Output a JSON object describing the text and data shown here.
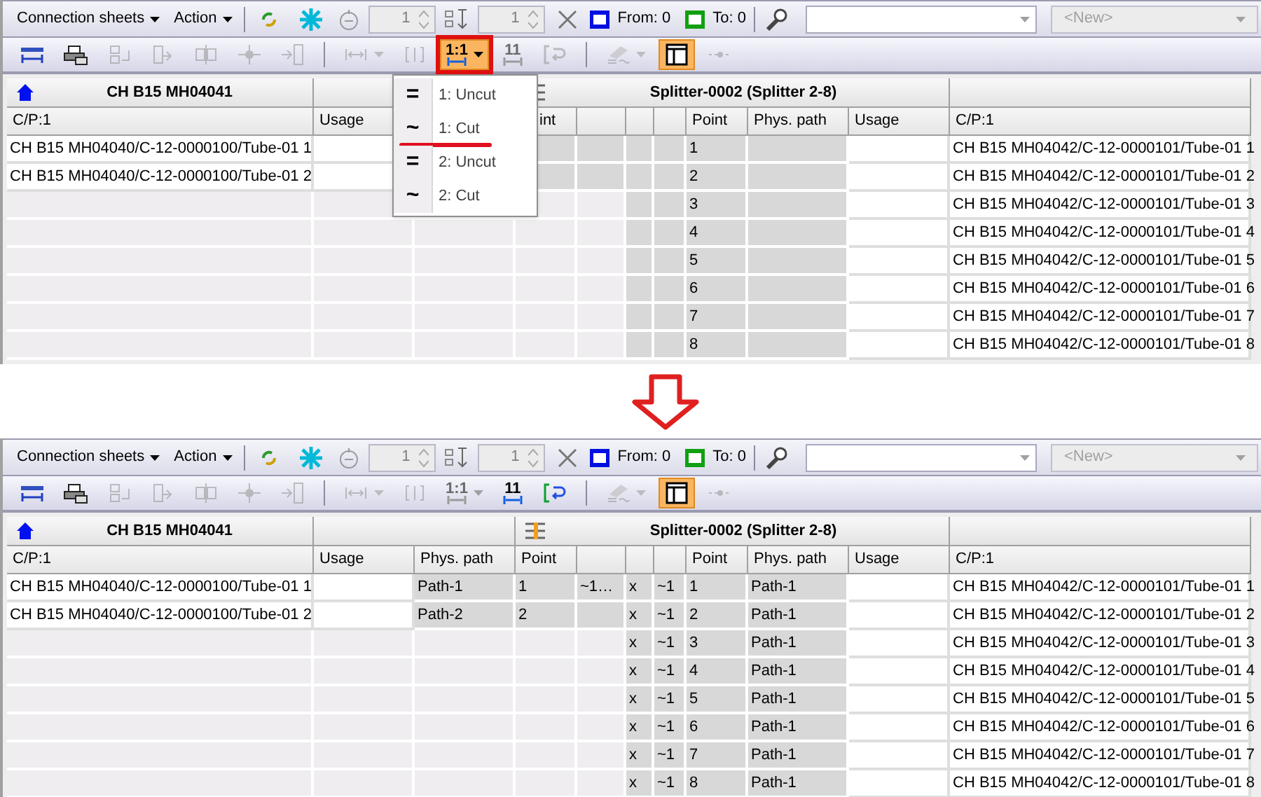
{
  "panels": [
    {
      "toolbar": {
        "menus": [
          "Connection sheets",
          "Action"
        ],
        "spin_1": "1",
        "spin_2": "1",
        "from": "From: 0",
        "to": "To: 0",
        "combo_new": "<New>"
      },
      "tools": [
        {
          "kind": "ruler",
          "disabled": false,
          "active": false
        },
        {
          "kind": "printer",
          "disabled": false,
          "active": false
        },
        {
          "kind": "box-in",
          "disabled": true,
          "active": false
        },
        {
          "kind": "box-out",
          "disabled": true,
          "active": false
        },
        {
          "kind": "split",
          "disabled": true,
          "active": false
        },
        {
          "kind": "node",
          "disabled": true,
          "active": false
        },
        {
          "kind": "insert",
          "disabled": true,
          "active": false
        },
        {
          "kind": "separator"
        },
        {
          "kind": "span",
          "disabled": true,
          "active": false,
          "dropdown": true
        },
        {
          "kind": "bracket",
          "disabled": true,
          "active": false
        },
        {
          "kind": "ratio",
          "label": "1:1",
          "disabled": false,
          "active": true,
          "dropdown": true,
          "marked": true
        },
        {
          "kind": "ratio",
          "label": "11",
          "disabled": true,
          "active": false
        },
        {
          "kind": "swap",
          "disabled": true,
          "active": false
        },
        {
          "kind": "separator"
        },
        {
          "kind": "wave",
          "disabled": true,
          "active": false,
          "dropdown": true
        },
        {
          "kind": "layout",
          "disabled": false,
          "active": true
        },
        {
          "kind": "line",
          "disabled": true,
          "active": false
        }
      ],
      "table": {
        "groups": [
          {
            "kind": "device",
            "title": "CH B15 MH04041"
          },
          {
            "kind": "empty"
          },
          {
            "kind": "splitter",
            "title": "Splitter-0002 (Splitter 2-8)"
          },
          {
            "kind": "empty"
          }
        ],
        "columns": [
          {
            "label": "C/P:1"
          },
          {
            "label": "Usage"
          },
          null,
          {
            "label": "int",
            "clipped": true
          },
          {},
          {},
          {},
          {
            "label": "Point"
          },
          {
            "label": "Phys. path"
          },
          {
            "label": "Usage"
          },
          {
            "label": "C/P:1"
          }
        ],
        "rows": [
          [
            {
              "text": "CH B15 MH04040/C-12-0000100/Tube-01 1",
              "kind": "plain"
            },
            {
              "kind": "plain"
            },
            null,
            {
              "kind": "shaded"
            },
            {
              "kind": "shaded"
            },
            {
              "kind": "shaded"
            },
            {
              "kind": "shaded"
            },
            {
              "text": "1",
              "kind": "shaded"
            },
            {
              "kind": "shaded"
            },
            {
              "kind": "plain"
            },
            {
              "text": "CH B15 MH04042/C-12-0000101/Tube-01 1",
              "kind": "plain"
            }
          ],
          [
            {
              "text": "CH B15 MH04040/C-12-0000100/Tube-01 2",
              "kind": "plain"
            },
            {
              "kind": "plain"
            },
            null,
            {
              "kind": "shaded"
            },
            {
              "kind": "shaded"
            },
            {
              "kind": "shaded"
            },
            {
              "kind": "shaded"
            },
            {
              "text": "2",
              "kind": "shaded"
            },
            {
              "kind": "shaded"
            },
            {
              "kind": "plain"
            },
            {
              "text": "CH B15 MH04042/C-12-0000101/Tube-01 2",
              "kind": "plain"
            }
          ],
          [
            {
              "kind": "unused"
            },
            {
              "kind": "unused"
            },
            {
              "kind": "unused"
            },
            {
              "kind": "unused"
            },
            {
              "kind": "unused"
            },
            {
              "kind": "shaded"
            },
            {
              "kind": "shaded"
            },
            {
              "text": "3",
              "kind": "shaded"
            },
            {
              "kind": "shaded"
            },
            {
              "kind": "plain"
            },
            {
              "text": "CH B15 MH04042/C-12-0000101/Tube-01 3",
              "kind": "plain"
            }
          ],
          [
            {
              "kind": "unused"
            },
            {
              "kind": "unused"
            },
            {
              "kind": "unused"
            },
            {
              "kind": "unused"
            },
            {
              "kind": "unused"
            },
            {
              "kind": "shaded"
            },
            {
              "kind": "shaded"
            },
            {
              "text": "4",
              "kind": "shaded"
            },
            {
              "kind": "shaded"
            },
            {
              "kind": "plain"
            },
            {
              "text": "CH B15 MH04042/C-12-0000101/Tube-01 4",
              "kind": "plain"
            }
          ],
          [
            {
              "kind": "unused"
            },
            {
              "kind": "unused"
            },
            {
              "kind": "unused"
            },
            {
              "kind": "unused"
            },
            {
              "kind": "unused"
            },
            {
              "kind": "shaded"
            },
            {
              "kind": "shaded"
            },
            {
              "text": "5",
              "kind": "shaded"
            },
            {
              "kind": "shaded"
            },
            {
              "kind": "plain"
            },
            {
              "text": "CH B15 MH04042/C-12-0000101/Tube-01 5",
              "kind": "plain"
            }
          ],
          [
            {
              "kind": "unused"
            },
            {
              "kind": "unused"
            },
            {
              "kind": "unused"
            },
            {
              "kind": "unused"
            },
            {
              "kind": "unused"
            },
            {
              "kind": "shaded"
            },
            {
              "kind": "shaded"
            },
            {
              "text": "6",
              "kind": "shaded"
            },
            {
              "kind": "shaded"
            },
            {
              "kind": "plain"
            },
            {
              "text": "CH B15 MH04042/C-12-0000101/Tube-01 6",
              "kind": "plain"
            }
          ],
          [
            {
              "kind": "unused"
            },
            {
              "kind": "unused"
            },
            {
              "kind": "unused"
            },
            {
              "kind": "unused"
            },
            {
              "kind": "unused"
            },
            {
              "kind": "shaded"
            },
            {
              "kind": "shaded"
            },
            {
              "text": "7",
              "kind": "shaded"
            },
            {
              "kind": "shaded"
            },
            {
              "kind": "plain"
            },
            {
              "text": "CH B15 MH04042/C-12-0000101/Tube-01 7",
              "kind": "plain"
            }
          ],
          [
            {
              "kind": "unused"
            },
            {
              "kind": "unused"
            },
            {
              "kind": "unused"
            },
            {
              "kind": "unused"
            },
            {
              "kind": "unused"
            },
            {
              "kind": "shaded"
            },
            {
              "kind": "shaded"
            },
            {
              "text": "8",
              "kind": "shaded"
            },
            {
              "kind": "shaded"
            },
            {
              "kind": "plain"
            },
            {
              "text": "CH B15 MH04042/C-12-0000101/Tube-01 8",
              "kind": "plain"
            }
          ]
        ]
      },
      "menu": {
        "items": [
          {
            "glyph": "=",
            "label": "1: Uncut",
            "marked": false
          },
          {
            "glyph": "~",
            "label": "1: Cut",
            "marked": true
          },
          {
            "glyph": "=",
            "label": "2: Uncut",
            "marked": false
          },
          {
            "glyph": "~",
            "label": "2: Cut",
            "marked": false
          }
        ]
      }
    },
    {
      "toolbar": {
        "menus": [
          "Connection sheets",
          "Action"
        ],
        "spin_1": "1",
        "spin_2": "1",
        "from": "From: 0",
        "to": "To: 0",
        "combo_new": "<New>"
      },
      "tools": [
        {
          "kind": "ruler",
          "disabled": false,
          "active": false
        },
        {
          "kind": "printer",
          "disabled": false,
          "active": false
        },
        {
          "kind": "box-in",
          "disabled": true,
          "active": false
        },
        {
          "kind": "box-out",
          "disabled": true,
          "active": false
        },
        {
          "kind": "split",
          "disabled": true,
          "active": false
        },
        {
          "kind": "node",
          "disabled": true,
          "active": false
        },
        {
          "kind": "insert",
          "disabled": true,
          "active": false
        },
        {
          "kind": "separator"
        },
        {
          "kind": "span",
          "disabled": true,
          "active": false,
          "dropdown": true
        },
        {
          "kind": "bracket",
          "disabled": true,
          "active": false
        },
        {
          "kind": "ratio",
          "label": "1:1",
          "disabled": true,
          "active": false,
          "dropdown": true
        },
        {
          "kind": "ratio",
          "label": "11",
          "disabled": false,
          "active": false
        },
        {
          "kind": "swap",
          "disabled": false,
          "active": false
        },
        {
          "kind": "separator"
        },
        {
          "kind": "wave",
          "disabled": true,
          "active": false,
          "dropdown": true
        },
        {
          "kind": "layout",
          "disabled": false,
          "active": true
        },
        {
          "kind": "line",
          "disabled": true,
          "active": false
        }
      ],
      "table": {
        "groups": [
          {
            "kind": "device",
            "title": "CH B15 MH04041"
          },
          {
            "kind": "empty"
          },
          {
            "kind": "splitter",
            "title": "Splitter-0002 (Splitter 2-8)"
          },
          {
            "kind": "empty"
          }
        ],
        "columns": [
          {
            "label": "C/P:1"
          },
          {
            "label": "Usage"
          },
          {
            "label": "Phys. path"
          },
          {
            "label": "Point"
          },
          {},
          {},
          {},
          {
            "label": "Point"
          },
          {
            "label": "Phys. path"
          },
          {
            "label": "Usage"
          },
          {
            "label": "C/P:1"
          }
        ],
        "rows": [
          [
            {
              "text": "CH B15 MH04040/C-12-0000100/Tube-01 1",
              "kind": "plain"
            },
            {
              "kind": "plain"
            },
            {
              "text": "Path-1",
              "kind": "shaded"
            },
            {
              "text": "1",
              "kind": "shaded"
            },
            {
              "text": "~1…",
              "kind": "shaded"
            },
            {
              "text": "x",
              "kind": "shaded"
            },
            {
              "text": "~1",
              "kind": "shaded"
            },
            {
              "text": "1",
              "kind": "shaded"
            },
            {
              "text": "Path-1",
              "kind": "shaded"
            },
            {
              "kind": "plain"
            },
            {
              "text": "CH B15 MH04042/C-12-0000101/Tube-01 1",
              "kind": "plain"
            }
          ],
          [
            {
              "text": "CH B15 MH04040/C-12-0000100/Tube-01 2",
              "kind": "plain"
            },
            {
              "kind": "plain"
            },
            {
              "text": "Path-2",
              "kind": "shaded"
            },
            {
              "text": "2",
              "kind": "shaded"
            },
            {
              "kind": "shaded"
            },
            {
              "text": "x",
              "kind": "shaded"
            },
            {
              "text": "~1",
              "kind": "shaded"
            },
            {
              "text": "2",
              "kind": "shaded"
            },
            {
              "text": "Path-1",
              "kind": "shaded"
            },
            {
              "kind": "plain"
            },
            {
              "text": "CH B15 MH04042/C-12-0000101/Tube-01 2",
              "kind": "plain"
            }
          ],
          [
            {
              "kind": "unused"
            },
            {
              "kind": "unused"
            },
            {
              "kind": "unused"
            },
            {
              "kind": "unused"
            },
            {
              "kind": "unused"
            },
            {
              "text": "x",
              "kind": "shaded"
            },
            {
              "text": "~1",
              "kind": "shaded"
            },
            {
              "text": "3",
              "kind": "shaded"
            },
            {
              "text": "Path-1",
              "kind": "shaded"
            },
            {
              "kind": "plain"
            },
            {
              "text": "CH B15 MH04042/C-12-0000101/Tube-01 3",
              "kind": "plain"
            }
          ],
          [
            {
              "kind": "unused"
            },
            {
              "kind": "unused"
            },
            {
              "kind": "unused"
            },
            {
              "kind": "unused"
            },
            {
              "kind": "unused"
            },
            {
              "text": "x",
              "kind": "shaded"
            },
            {
              "text": "~1",
              "kind": "shaded"
            },
            {
              "text": "4",
              "kind": "shaded"
            },
            {
              "text": "Path-1",
              "kind": "shaded"
            },
            {
              "kind": "plain"
            },
            {
              "text": "CH B15 MH04042/C-12-0000101/Tube-01 4",
              "kind": "plain"
            }
          ],
          [
            {
              "kind": "unused"
            },
            {
              "kind": "unused"
            },
            {
              "kind": "unused"
            },
            {
              "kind": "unused"
            },
            {
              "kind": "unused"
            },
            {
              "text": "x",
              "kind": "shaded"
            },
            {
              "text": "~1",
              "kind": "shaded"
            },
            {
              "text": "5",
              "kind": "shaded"
            },
            {
              "text": "Path-1",
              "kind": "shaded"
            },
            {
              "kind": "plain"
            },
            {
              "text": "CH B15 MH04042/C-12-0000101/Tube-01 5",
              "kind": "plain"
            }
          ],
          [
            {
              "kind": "unused"
            },
            {
              "kind": "unused"
            },
            {
              "kind": "unused"
            },
            {
              "kind": "unused"
            },
            {
              "kind": "unused"
            },
            {
              "text": "x",
              "kind": "shaded"
            },
            {
              "text": "~1",
              "kind": "shaded"
            },
            {
              "text": "6",
              "kind": "shaded"
            },
            {
              "text": "Path-1",
              "kind": "shaded"
            },
            {
              "kind": "plain"
            },
            {
              "text": "CH B15 MH04042/C-12-0000101/Tube-01 6",
              "kind": "plain"
            }
          ],
          [
            {
              "kind": "unused"
            },
            {
              "kind": "unused"
            },
            {
              "kind": "unused"
            },
            {
              "kind": "unused"
            },
            {
              "kind": "unused"
            },
            {
              "text": "x",
              "kind": "shaded"
            },
            {
              "text": "~1",
              "kind": "shaded"
            },
            {
              "text": "7",
              "kind": "shaded"
            },
            {
              "text": "Path-1",
              "kind": "shaded"
            },
            {
              "kind": "plain"
            },
            {
              "text": "CH B15 MH04042/C-12-0000101/Tube-01 7",
              "kind": "plain"
            }
          ],
          [
            {
              "kind": "unused"
            },
            {
              "kind": "unused"
            },
            {
              "kind": "unused"
            },
            {
              "kind": "unused"
            },
            {
              "kind": "unused"
            },
            {
              "text": "x",
              "kind": "shaded"
            },
            {
              "text": "~1",
              "kind": "shaded"
            },
            {
              "text": "8",
              "kind": "shaded"
            },
            {
              "text": "Path-1",
              "kind": "shaded"
            },
            {
              "kind": "plain"
            },
            {
              "text": "CH B15 MH04042/C-12-0000101/Tube-01 8",
              "kind": "plain"
            }
          ]
        ]
      }
    }
  ]
}
